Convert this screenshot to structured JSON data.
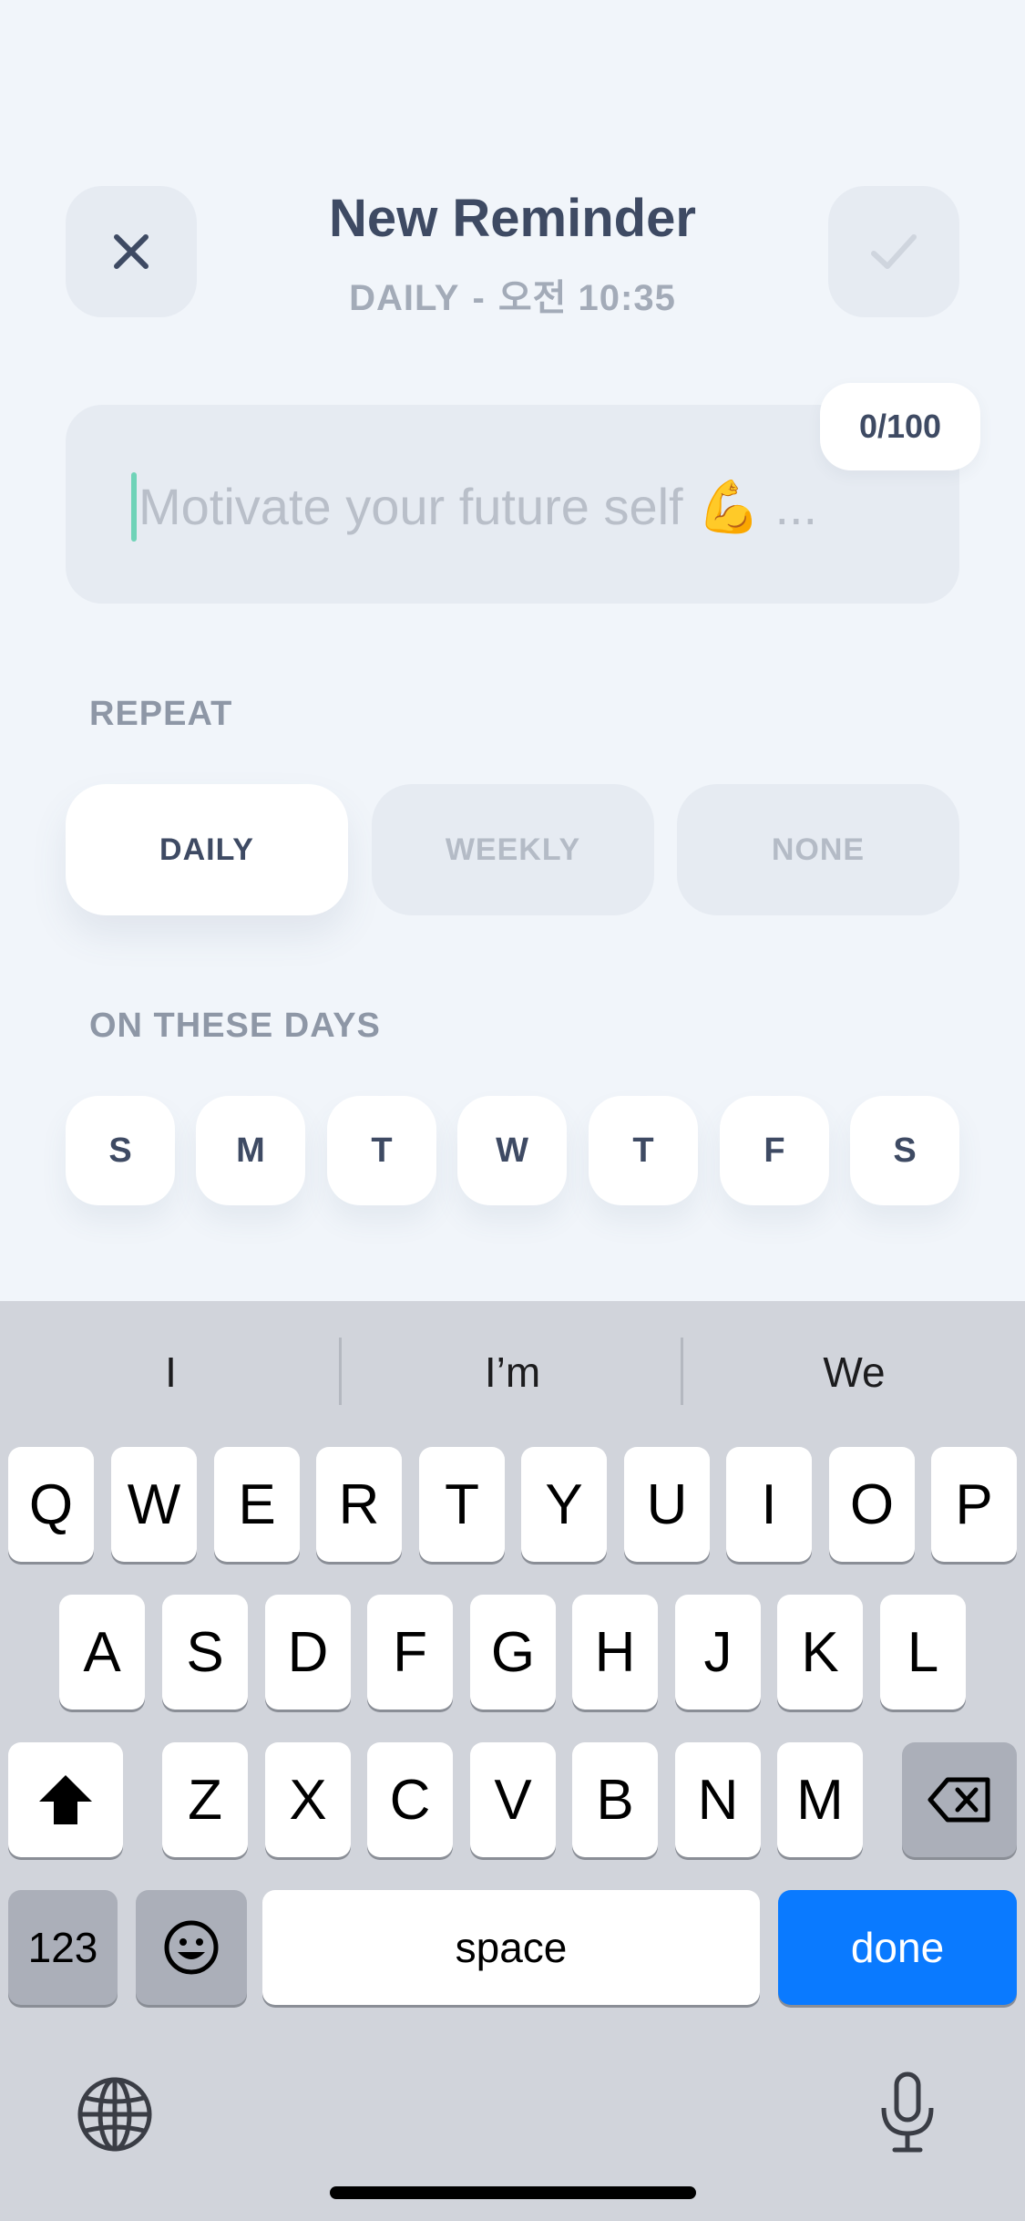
{
  "header": {
    "title": "New Reminder",
    "subtitle_repeat": "DAILY",
    "subtitle_sep": "-",
    "subtitle_time": "오전 10:35"
  },
  "input": {
    "placeholder": "Motivate your future self 💪 ...",
    "counter": "0/100"
  },
  "repeat": {
    "label": "REPEAT",
    "options": [
      "DAILY",
      "WEEKLY",
      "NONE"
    ],
    "selected": "DAILY"
  },
  "days": {
    "label": "ON THESE DAYS",
    "items": [
      "S",
      "M",
      "T",
      "W",
      "T",
      "F",
      "S"
    ]
  },
  "keyboard": {
    "suggestions": [
      "I",
      "I’m",
      "We"
    ],
    "row1": [
      "Q",
      "W",
      "E",
      "R",
      "T",
      "Y",
      "U",
      "I",
      "O",
      "P"
    ],
    "row2": [
      "A",
      "S",
      "D",
      "F",
      "G",
      "H",
      "J",
      "K",
      "L"
    ],
    "row3": [
      "Z",
      "X",
      "C",
      "V",
      "B",
      "N",
      "M"
    ],
    "numbers_key": "123",
    "space_key": "space",
    "done_key": "done"
  },
  "colors": {
    "background": "#f1f5fa",
    "accent_done": "#0a7aff",
    "caret": "#6fd3b8",
    "text_dark": "#3e4a63"
  }
}
